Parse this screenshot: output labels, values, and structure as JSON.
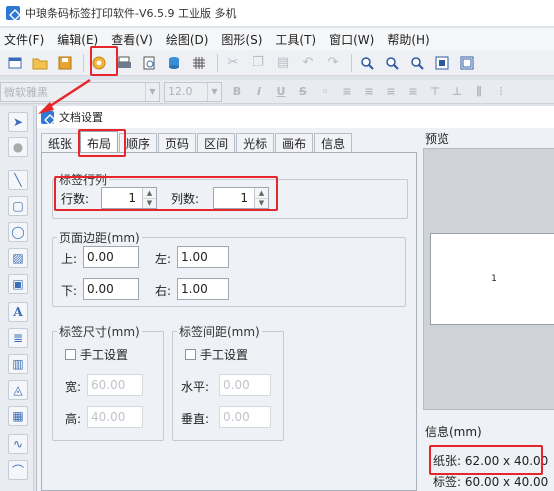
{
  "app": {
    "title": "中琅条码标签打印软件-V6.5.9 工业版 多机"
  },
  "menu": [
    "文件(F)",
    "编辑(E)",
    "查看(V)",
    "绘图(D)",
    "图形(S)",
    "工具(T)",
    "窗口(W)",
    "帮助(H)"
  ],
  "format_toolbar": {
    "font": "微软雅黑",
    "size": "12.0",
    "buttons": [
      "B",
      "I",
      "U",
      "S"
    ]
  },
  "dialog": {
    "title": "文档设置",
    "tabs": [
      "纸张",
      "布局",
      "顺序",
      "页码",
      "区间",
      "光标",
      "画布",
      "信息"
    ],
    "active_tab": "布局",
    "rows_cols": {
      "legend": "标签行列",
      "rows_label": "行数:",
      "rows": "1",
      "cols_label": "列数:",
      "cols": "1"
    },
    "margins": {
      "legend": "页面边距(mm)",
      "top_label": "上:",
      "top": "0.00",
      "left_label": "左:",
      "left": "1.00",
      "bottom_label": "下:",
      "bottom": "0.00",
      "right_label": "右:",
      "right": "1.00"
    },
    "label_size": {
      "legend": "标签尺寸(mm)",
      "manual": "手工设置",
      "width_label": "宽:",
      "width": "60.00",
      "height_label": "高:",
      "height": "40.00"
    },
    "label_gap": {
      "legend": "标签间距(mm)",
      "manual": "手工设置",
      "h_label": "水平:",
      "h": "0.00",
      "v_label": "垂直:",
      "v": "0.00"
    },
    "preview": {
      "label": "预览",
      "card_text": "1"
    },
    "info": {
      "label": "信息(mm)",
      "paper": "纸张: 62.00 x 40.00",
      "label_size": "标签: 60.00 x 40.00"
    }
  },
  "colors": {
    "highlight": "#e5262a",
    "accent": "#2f78d4"
  }
}
